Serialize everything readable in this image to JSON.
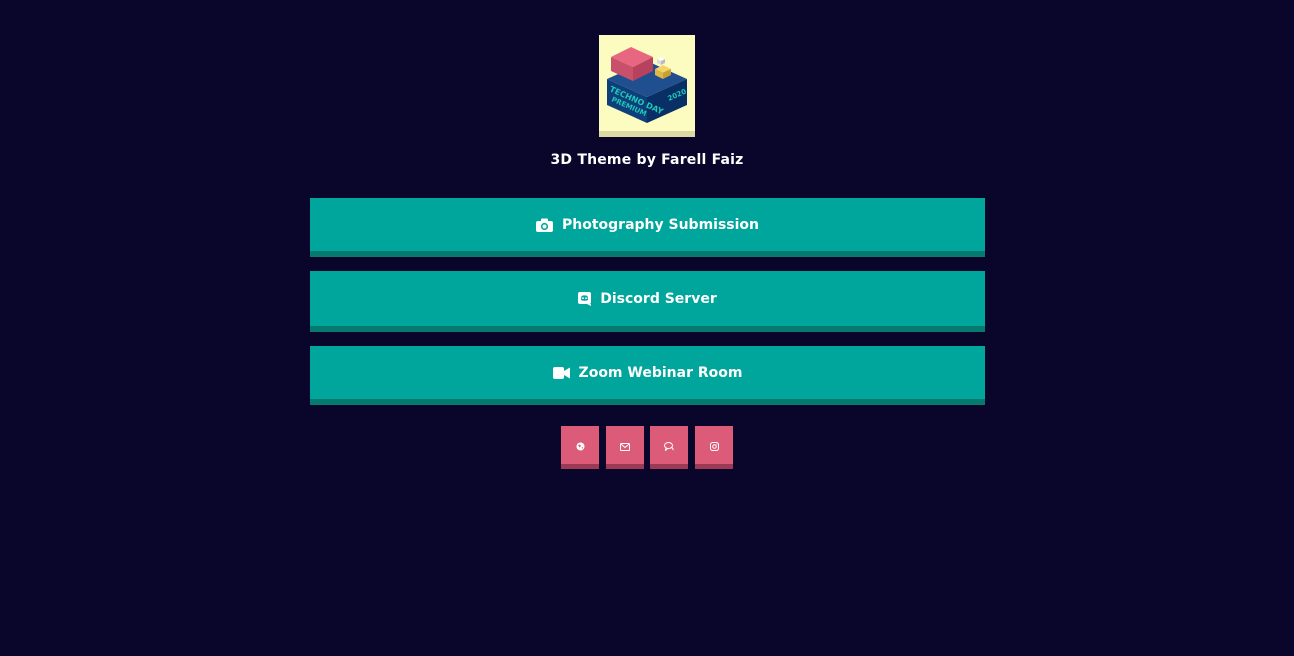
{
  "profile": {
    "avatar_text_1": "TECHNO DAY",
    "avatar_text_2": "PREMIUM",
    "avatar_text_3": "2020",
    "title": "3D Theme by Farell Faiz"
  },
  "links": [
    {
      "label": "Photography Submission",
      "icon": "camera-icon"
    },
    {
      "label": "Discord Server",
      "icon": "discord-icon"
    },
    {
      "label": "Zoom Webinar Room",
      "icon": "video-camera-icon"
    }
  ],
  "socials": [
    {
      "icon": "globe-icon"
    },
    {
      "icon": "envelope-icon"
    },
    {
      "icon": "chat-icon"
    },
    {
      "icon": "instagram-icon"
    }
  ],
  "colors": {
    "background": "#0a062b",
    "button": "#00a59b",
    "button_shadow": "#077a6f",
    "social": "#dc5b78",
    "social_shadow": "#9c3a55",
    "avatar_bg": "#fdfcc0"
  }
}
